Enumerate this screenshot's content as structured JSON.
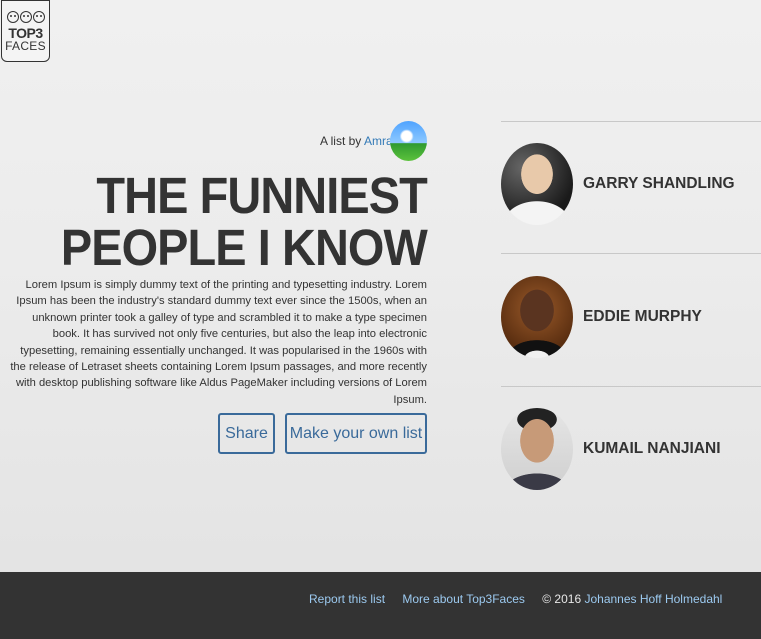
{
  "logo": {
    "line1": "TOP3",
    "line2": "FACES"
  },
  "list": {
    "byline_prefix": "A list by",
    "author": "Amravi Dev",
    "title_line1": "THE FUNNIEST",
    "title_line2": "PEOPLE I KNOW",
    "description": "Lorem Ipsum is simply dummy text of the printing and typesetting industry. Lorem Ipsum has been the industry's standard dummy text ever since the 1500s, when an unknown printer took a galley of type and scrambled it to make a type specimen book. It has survived not only five centuries, but also the leap into electronic typesetting, remaining essentially unchanged. It was popularised in the 1960s with the release of Letraset sheets containing Lorem Ipsum passages, and more recently with desktop publishing software like Aldus PageMaker including versions of Lorem Ipsum."
  },
  "buttons": {
    "share": "Share",
    "make_list": "Make your own list"
  },
  "people": [
    {
      "name": "GARRY SHANDLING",
      "photo": "comedian-with-microphone-photo"
    },
    {
      "name": "EDDIE MURPHY",
      "photo": "smiling-man-in-suit-photo"
    },
    {
      "name": "KUMAIL NANJIANI",
      "photo": "man-portrait-photo"
    }
  ],
  "footer": {
    "report": "Report this list",
    "about": "More about Top3Faces",
    "copyright": "© 2016",
    "owner": "Johannes Hoff Holmedahl"
  },
  "colors": {
    "link": "#337ab7",
    "button": "#3a6a9a",
    "footer_bg": "#333333",
    "footer_link": "#9ccaf0"
  }
}
